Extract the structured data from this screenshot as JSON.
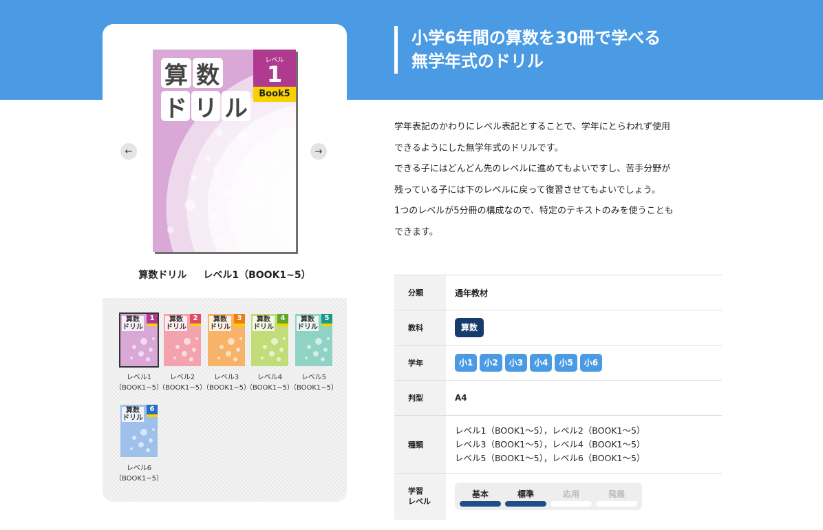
{
  "headline": {
    "line1": "小学6年間の算数を30冊で学べる",
    "line2": "無学年式のドリル"
  },
  "description": [
    "学年表記のかわりにレベル表記とすることで、学年にとらわれず使用",
    "できるようにした無学年式のドリルです。",
    "できる子にはどんどん先のレベルに進めてもよいですし、苦手分野が",
    "残っている子には下のレベルに戻って復習させてもよいでしょう。",
    "1つのレベルが5分冊の構成なので、特定のテキストのみを使うことも",
    "できます。"
  ],
  "cover": {
    "title_chars": [
      "算",
      "数",
      "ド",
      "リ",
      "ル"
    ],
    "level_label": "レベル",
    "level_num": "1",
    "book_label": "Book5",
    "bg_color": "#d9a8d6",
    "accent_color": "#b03a8f",
    "caption_title": "算数ドリル",
    "caption_level": "レベル1（BOOK1~5）",
    "prev_icon": "arrow-left-icon",
    "next_icon": "arrow-right-icon"
  },
  "thumbnails": [
    {
      "num": "1",
      "title": "算数\nドリル",
      "label1": "レベル1",
      "label2": "（BOOK1~5）",
      "color": "#d9a8d6",
      "accent": "#b03a8f",
      "active": true
    },
    {
      "num": "2",
      "title": "算数\nドリル",
      "label1": "レベル2",
      "label2": "（BOOK1~5）",
      "color": "#f3a3ad",
      "accent": "#e04a63",
      "active": false
    },
    {
      "num": "3",
      "title": "算数\nドリル",
      "label1": "レベル3",
      "label2": "（BOOK1~5）",
      "color": "#f8b36a",
      "accent": "#ef7b12",
      "active": false
    },
    {
      "num": "4",
      "title": "算数\nドリル",
      "label1": "レベル4",
      "label2": "（BOOK1~5）",
      "color": "#c3dc7a",
      "accent": "#5fa72b",
      "active": false
    },
    {
      "num": "5",
      "title": "算数\nドリル",
      "label1": "レベル5",
      "label2": "（BOOK1~5）",
      "color": "#8fd3c4",
      "accent": "#1a9a8a",
      "active": false
    },
    {
      "num": "6",
      "title": "算数\nドリル",
      "label1": "レベル6",
      "label2": "（BOOK1~5）",
      "color": "#9ec0ea",
      "accent": "#2a6cc6",
      "active": false
    }
  ],
  "spec": {
    "category_key": "分類",
    "category_value": "通年教材",
    "subject_key": "教科",
    "subject_value": "算数",
    "grade_key": "学年",
    "grades": [
      "小1",
      "小2",
      "小3",
      "小4",
      "小5",
      "小6"
    ],
    "size_key": "判型",
    "size_value": "A4",
    "types_key": "種類",
    "types_lines": [
      "レベル1（BOOK1～5），レベル2（BOOK1～5）",
      "レベル3（BOOK1～5），レベル4（BOOK1～5）",
      "レベル5（BOOK1～5），レベル6（BOOK1～5）"
    ],
    "level_key_line1": "学習",
    "level_key_line2": "レベル",
    "levels": [
      {
        "label": "基本",
        "active": true
      },
      {
        "label": "標準",
        "active": true
      },
      {
        "label": "応用",
        "active": false
      },
      {
        "label": "発展",
        "active": false
      }
    ],
    "active_color": "#1f4f84",
    "inactive_color": "#ffffff"
  },
  "colors": {
    "header_blue": "#4a9be3",
    "navy": "#173b6c"
  }
}
